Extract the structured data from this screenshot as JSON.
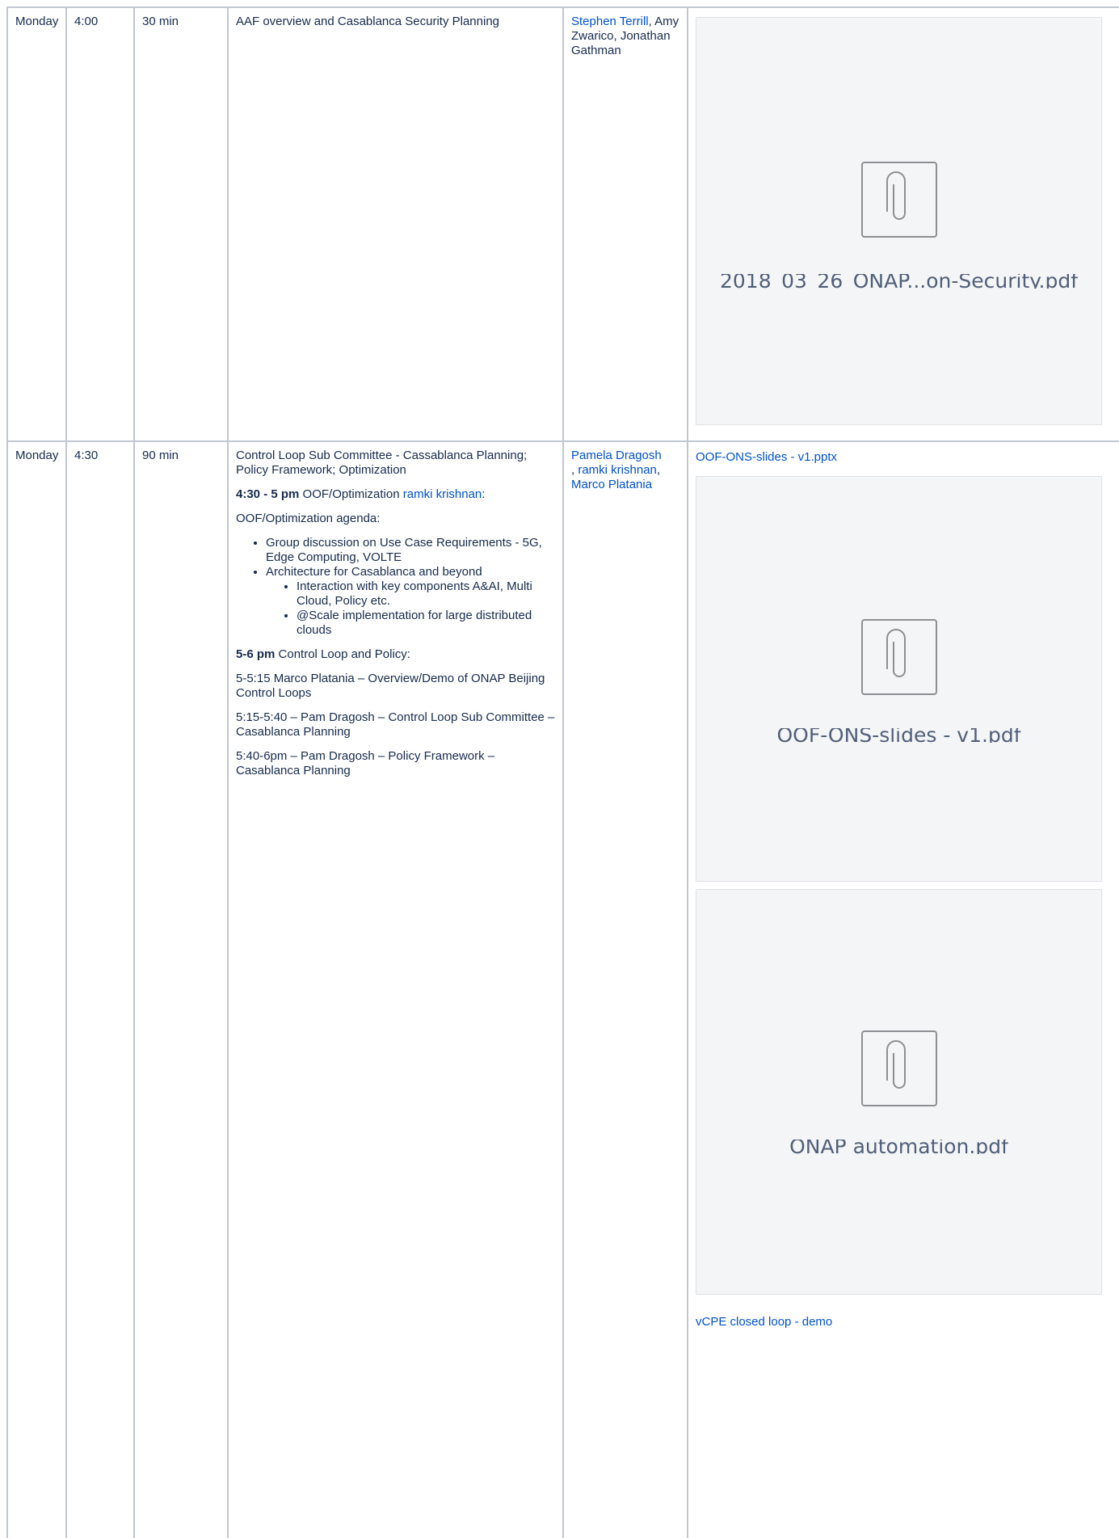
{
  "rows": [
    {
      "day": "Monday",
      "time": "4:00",
      "duration": "30 min",
      "topic": "AAF overview and Casablanca Security Planning",
      "presenters": {
        "link": "Stephen Terrill",
        "sep": ",",
        "rest": "Amy Zwarico, Jonathan Gathman"
      },
      "attachments": [
        {
          "name": "2018_03_26_ONAP...on-Security.pdf",
          "icon": "paperclip-icon"
        }
      ]
    },
    {
      "day": "Monday",
      "time": "4:30",
      "duration": "90 min",
      "topic": "Control Loop Sub Committee - Cassablanca Planning; Policy Framework; Optimization",
      "oof_heading_bold": "4:30 - 5 pm",
      "oof_heading_text": "OOF/Optimization",
      "oof_heading_link": "ramki krishnan",
      "oof_heading_end": ":",
      "oof_agenda_title": "OOF/Optimization agenda:",
      "agenda": {
        "item1": "Group discussion on Use Case Requirements - 5G, Edge Computing, VOLTE",
        "item2": "Architecture for Casablanca and beyond",
        "sub1": "Interaction with key components A&AI, Multi Cloud, Policy etc.",
        "sub2": "@Scale implementation for large distributed clouds"
      },
      "cl_heading_bold": "5-6 pm",
      "cl_heading_text": "Control Loop and Policy:",
      "sessions": [
        "5-5:15 Marco Platania – Overview/Demo of ONAP Beijing Control Loops",
        "5:15-5:40 – Pam Dragosh – Control Loop Sub Committee – Casablanca Planning",
        "5:40-6pm – Pam Dragosh – Policy Framework – Casablanca Planning"
      ],
      "presenters": {
        "p1": "Pamela Dragosh",
        "sep1": ",",
        "p2": "ramki krishnan",
        "sep2": ",",
        "p3": "Marco Platania"
      },
      "links": {
        "slides": "OOF-ONS-slides - v1.pptx",
        "demo": "vCPE closed loop - demo"
      },
      "attachments": [
        {
          "name": "OOF-ONS-slides - v1.pdf",
          "icon": "paperclip-icon"
        },
        {
          "name": "ONAP automation.pdf",
          "icon": "paperclip-icon"
        }
      ]
    }
  ],
  "colors": {
    "link": "#0052cc",
    "border": "#c1c7d0",
    "preview_bg": "#f4f5f7",
    "text": "#172b4d"
  }
}
